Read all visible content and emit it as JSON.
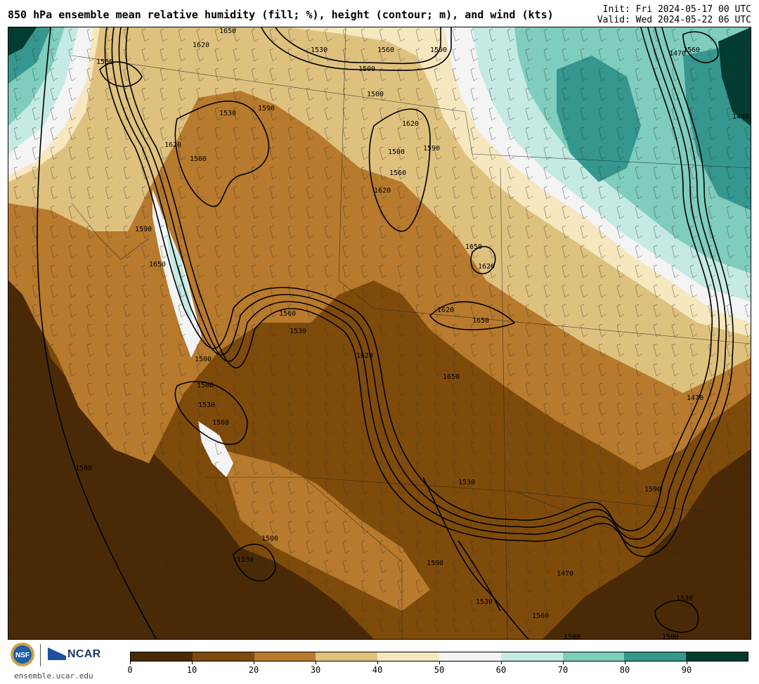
{
  "header": {
    "title": "850 hPa ensemble mean relative humidity (fill; %), height (contour; m), and wind (kts)",
    "init": "Init: Fri 2024-05-17 00 UTC",
    "valid": "Valid: Wed 2024-05-22 06 UTC"
  },
  "footer": {
    "site": "ensemble.ucar.edu",
    "ncar_label": "NCAR",
    "nsf_label": "NSF"
  },
  "colorbar": {
    "colors": [
      "#4a2a06",
      "#7f4b0b",
      "#b87a2c",
      "#dfc17e",
      "#f6e7bf",
      "#f4f4f4",
      "#c5eae3",
      "#7fcdbd",
      "#35978f",
      "#013c30"
    ],
    "tick_labels": [
      "0",
      "10",
      "20",
      "30",
      "40",
      "50",
      "60",
      "70",
      "80",
      "90"
    ]
  },
  "map": {
    "contour_labels": [
      "1560",
      "1620",
      "1650",
      "1530",
      "1590",
      "1500",
      "1560",
      "1530",
      "1590",
      "1500",
      "1620",
      "1470",
      "1440",
      "1650",
      "1620",
      "1560",
      "1500",
      "1530",
      "1560",
      "1500",
      "1530",
      "1620",
      "1650",
      "1590",
      "1620",
      "1650",
      "1500",
      "1620",
      "1560",
      "1530",
      "1470",
      "1560",
      "1500",
      "1530",
      "1590",
      "1470",
      "1500",
      "1560",
      "1620",
      "1590",
      "1650",
      "1530",
      "1500",
      "1560",
      "1530",
      "1590",
      "1500"
    ]
  }
}
